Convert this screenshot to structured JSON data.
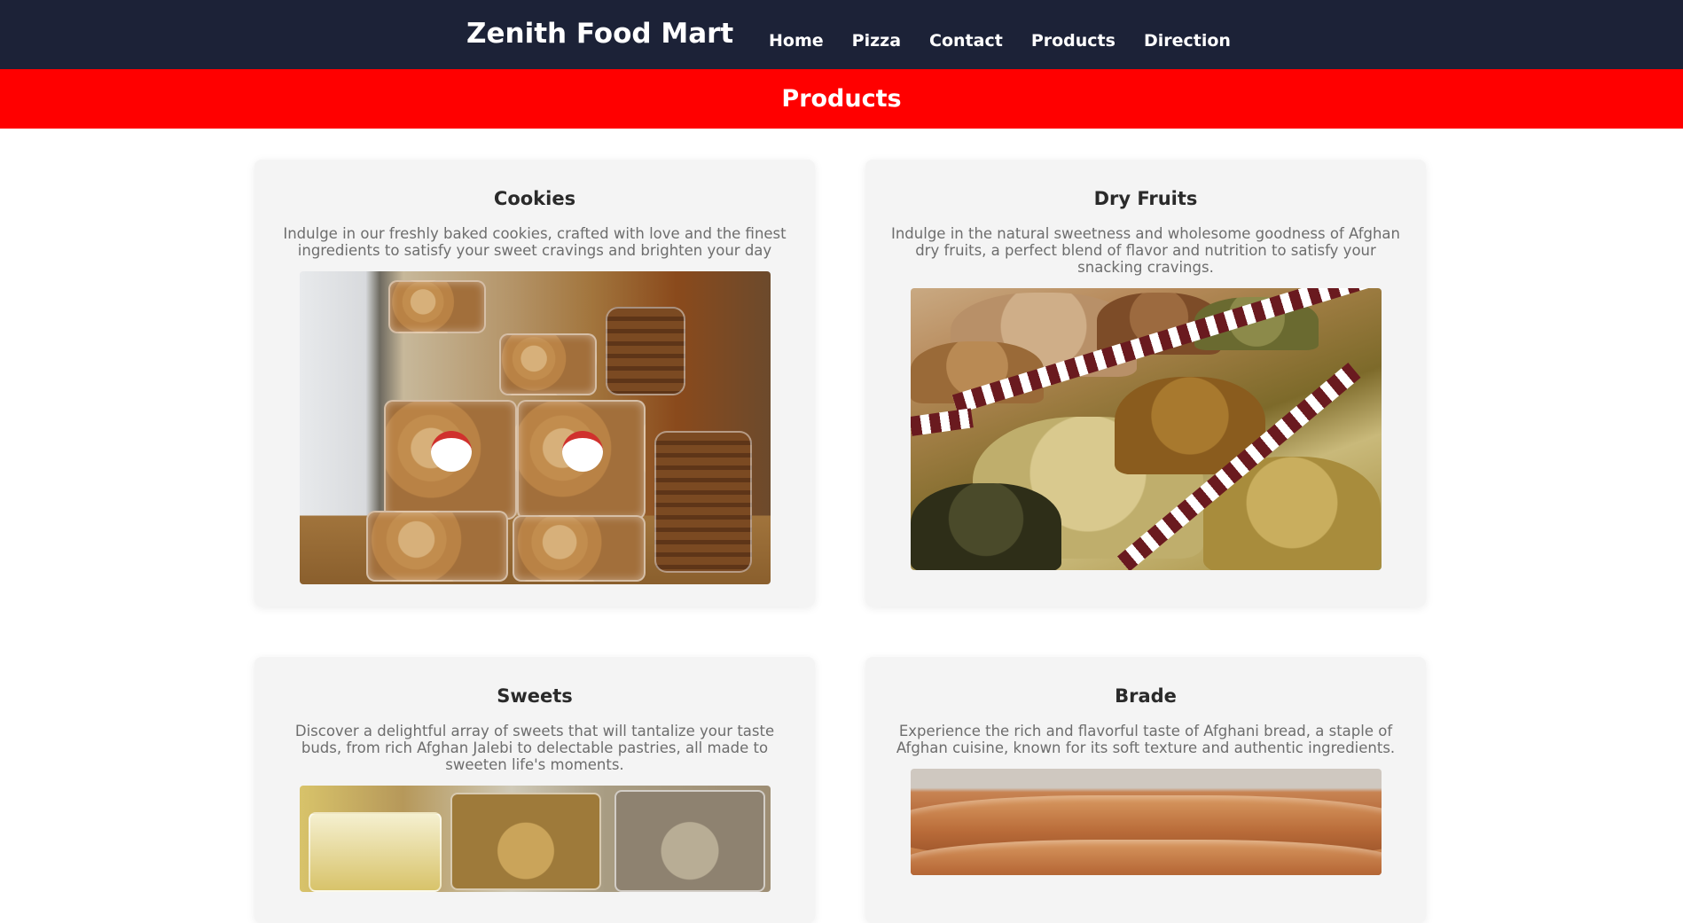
{
  "header": {
    "brand": "Zenith Food Mart",
    "nav": [
      "Home",
      "Pizza",
      "Contact",
      "Products",
      "Direction"
    ]
  },
  "page_title": "Products",
  "colors": {
    "header_bg": "#1c2237",
    "title_band_bg": "#ff0000",
    "card_bg": "#f4f4f4"
  },
  "products": [
    {
      "name": "Cookies",
      "description": "Indulge in our freshly baked cookies, crafted with love and the finest ingredients to satisfy your sweet cravings and brighten your day",
      "image_icon": "cookies-photo"
    },
    {
      "name": "Dry Fruits",
      "description": "Indulge in the natural sweetness and wholesome goodness of Afghan dry fruits, a perfect blend of flavor and nutrition to satisfy your snacking cravings.",
      "image_icon": "dry-fruits-photo"
    },
    {
      "name": "Sweets",
      "description": "Discover a delightful array of sweets that will tantalize your taste buds, from rich Afghan Jalebi to delectable pastries, all made to sweeten life's moments.",
      "image_icon": "sweets-photo"
    },
    {
      "name": "Brade",
      "description": "Experience the rich and flavorful taste of Afghani bread, a staple of Afghan cuisine, known for its soft texture and authentic ingredients.",
      "image_icon": "bread-photo"
    }
  ]
}
